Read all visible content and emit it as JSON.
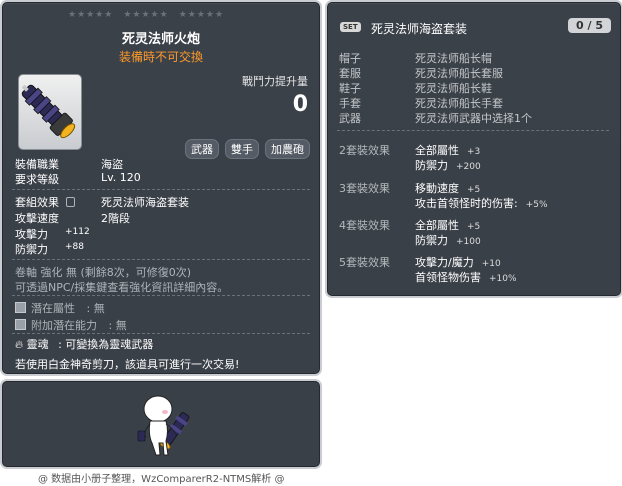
{
  "id_code": "01532071",
  "item": {
    "name": "死灵法师火炮",
    "subtitle": "装備時不可交換",
    "power_label": "戰鬥力提升量",
    "power_value": "0",
    "tags": [
      "武器",
      "雙手",
      "加農砲"
    ],
    "job_label": "裝備職業",
    "job_value": "海盜",
    "level_label": "要求等級",
    "level_value": "Lv. 120",
    "set_effect_label": "套組效果",
    "set_effect_value": "死灵法师海盗套装",
    "speed_label": "攻擊速度",
    "speed_value": "2階段",
    "atk_label": "攻擊力",
    "atk_value": "+112",
    "def_label": "防禦力",
    "def_value": "+88",
    "scroll_line": "卷軸 強化 無 (剩餘8次，可修復0次)",
    "npc_line": "可透過NPC/採集鍵查看強化資訊詳細內容。",
    "potential_label": "潛在屬性",
    "potential_value": ": 無",
    "add_potential_label": "附加潛在能力",
    "add_potential_value": ": 無",
    "soul_label": "靈魂",
    "soul_value": ": 可變換為靈魂武器",
    "trade_note": "若使用白金神奇剪刀，該道具可進行一次交易!"
  },
  "set_panel": {
    "badge": "SET",
    "name": "死灵法师海盗套装",
    "count": "0 / 5",
    "items": [
      {
        "slot": "帽子",
        "name": "死灵法师船长帽"
      },
      {
        "slot": "套服",
        "name": "死灵法师船长套服"
      },
      {
        "slot": "鞋子",
        "name": "死灵法师船长鞋"
      },
      {
        "slot": "手套",
        "name": "死灵法师船长手套"
      },
      {
        "slot": "武器",
        "name": "死灵法师武器中选择1个"
      }
    ],
    "effects": [
      {
        "title": "2套裝效果",
        "lines": [
          {
            "text": "全部屬性",
            "val": "+3"
          },
          {
            "text": "防禦力",
            "val": "+200"
          }
        ]
      },
      {
        "title": "3套裝效果",
        "lines": [
          {
            "text": "移動速度",
            "val": "+5"
          },
          {
            "text": "攻击首领怪时的伤害:",
            "val": "+5%"
          }
        ]
      },
      {
        "title": "4套裝效果",
        "lines": [
          {
            "text": "全部屬性",
            "val": "+5"
          },
          {
            "text": "防禦力",
            "val": "+100"
          }
        ]
      },
      {
        "title": "5套裝效果",
        "lines": [
          {
            "text": "攻擊力/魔力",
            "val": "+10"
          },
          {
            "text": "首领怪物伤害",
            "val": "+10%"
          }
        ]
      }
    ]
  },
  "footer": "@ 数据由小册子整理，WzComparerR2-NTMS解析 @"
}
